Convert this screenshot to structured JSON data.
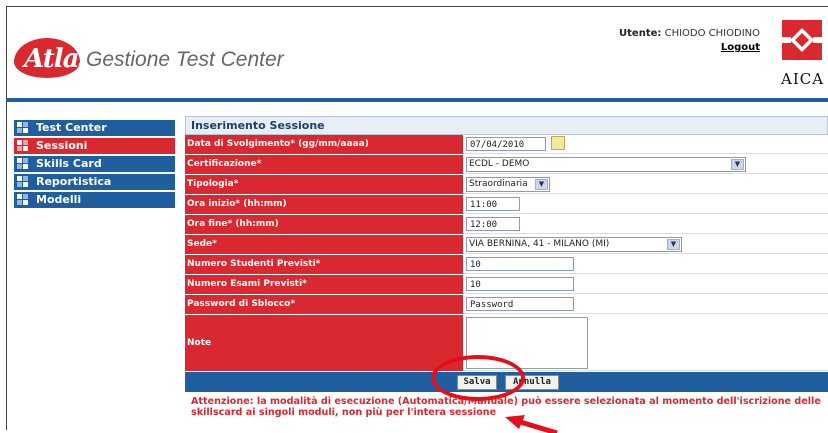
{
  "header": {
    "logo_text": "Atlas",
    "app_title": "Gestione Test Center",
    "user_label": "Utente:",
    "user_name": "CHIODO CHIODINO",
    "logout_label": "Logout",
    "partner_logo_text": "AICA"
  },
  "sidebar": {
    "items": [
      {
        "label": "Test Center",
        "active": false
      },
      {
        "label": "Sessioni",
        "active": true
      },
      {
        "label": "Skills Card",
        "active": false
      },
      {
        "label": "Reportistica",
        "active": false
      },
      {
        "label": "Modelli",
        "active": false
      }
    ]
  },
  "form": {
    "title": "Inserimento Sessione",
    "fields": {
      "data": {
        "label": "Data di Svolgimento* (gg/mm/aaaa)",
        "value": "07/04/2010"
      },
      "certificazione": {
        "label": "Certificazione*",
        "value": "ECDL - DEMO"
      },
      "tipologia": {
        "label": "Tipologia*",
        "value": "Straordinaria"
      },
      "ora_inizio": {
        "label": "Ora inizio* (hh:mm)",
        "value": "11:00"
      },
      "ora_fine": {
        "label": "Ora fine* (hh:mm)",
        "value": "12:00"
      },
      "sede": {
        "label": "Sede*",
        "value": "VIA BERNINA, 41 - MILANO (MI)"
      },
      "studenti": {
        "label": "Numero Studenti Previsti*",
        "value": "10"
      },
      "esami": {
        "label": "Numero Esami Previsti*",
        "value": "10"
      },
      "password": {
        "label": "Password di Sblocco*",
        "value": "Password"
      },
      "note": {
        "label": "Note",
        "value": ""
      }
    },
    "buttons": {
      "save": "Salva",
      "cancel": "Annulla"
    },
    "warning": "Attenzione: la modalità di esecuzione (Automatica/Manuale) può essere selezionata al momento dell'iscrizione delle skillscard ai singoli moduli, non più per l'intera sessione"
  },
  "colors": {
    "brand_red": "#d9282f",
    "brand_blue": "#1f5fa0",
    "annotation_red": "#e2101b"
  },
  "icons": [
    "calendar-icon",
    "dropdown-arrow-icon",
    "nav-squares-icon"
  ]
}
